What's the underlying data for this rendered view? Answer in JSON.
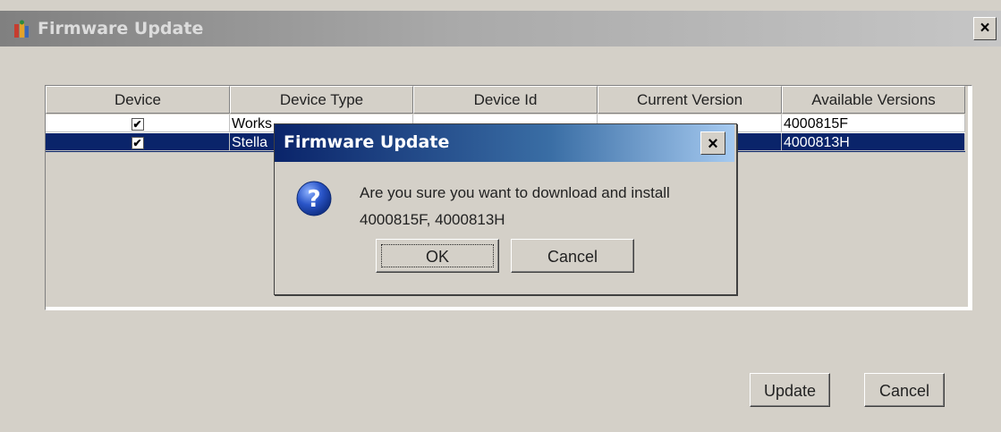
{
  "window": {
    "title": "Firmware Update",
    "close_label": "×"
  },
  "table": {
    "columns": [
      "Device",
      "Device Type",
      "Device Id",
      "Current Version",
      "Available Versions"
    ],
    "rows": [
      {
        "checked": true,
        "device_type": "Works",
        "device_id": "",
        "current_version": "",
        "available_versions": "4000815F",
        "selected": false
      },
      {
        "checked": true,
        "device_type": "Stella",
        "device_id": "",
        "current_version": "",
        "available_versions": "4000813H",
        "selected": true
      }
    ]
  },
  "footer": {
    "update_label": "Update",
    "cancel_label": "Cancel"
  },
  "dialog": {
    "title": "Firmware Update",
    "close_label": "×",
    "message_line1": "Are you sure you want to download and install",
    "message_line2": "4000815F, 4000813H",
    "ok_label": "OK",
    "cancel_label": "Cancel",
    "icon": "question-icon"
  },
  "colors": {
    "selection": "#0a246a",
    "dialog_title_start": "#0a246a",
    "dialog_title_end": "#a6caf0"
  }
}
